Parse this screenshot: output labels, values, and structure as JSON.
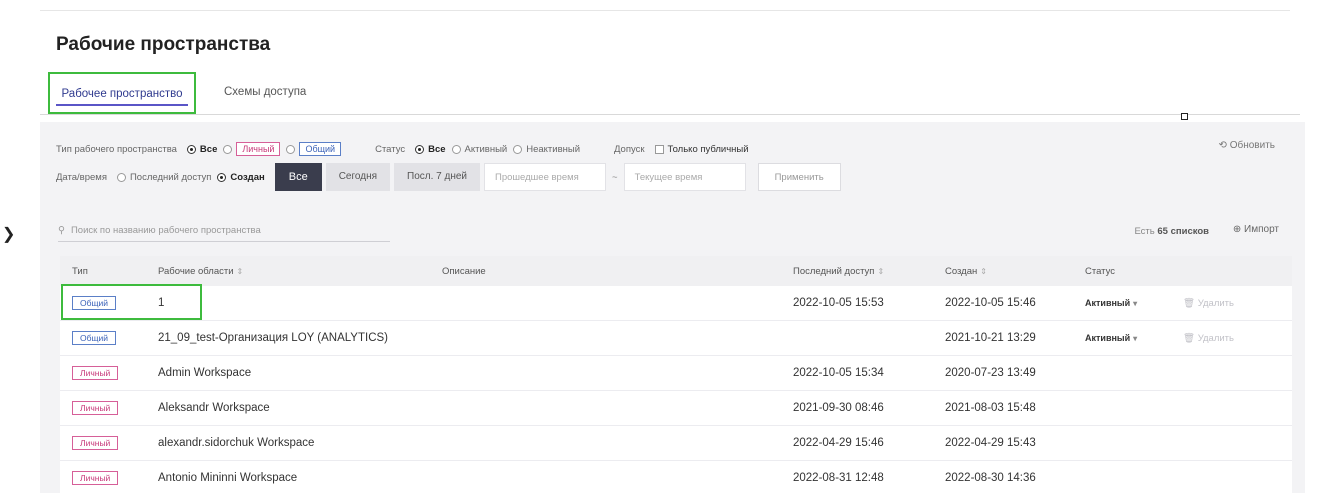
{
  "page": {
    "title": "Рабочие пространства"
  },
  "tabs": [
    {
      "label": "Рабочее пространство",
      "active": true
    },
    {
      "label": "Схемы доступа",
      "active": false
    }
  ],
  "filters": {
    "type_label": "Тип рабочего пространства",
    "type_options": {
      "all": "Все",
      "personal": "Личный",
      "shared": "Общий"
    },
    "status_label": "Статус",
    "status_options": {
      "all": "Все",
      "active": "Активный",
      "inactive": "Неактивный"
    },
    "access_label": "Допуск",
    "access_option": "Только публичный",
    "refresh_label": "Обновить",
    "datetime_label": "Дата/время",
    "date_options": {
      "last_access": "Последний доступ",
      "created": "Создан"
    },
    "periods": {
      "all": "Все",
      "today": "Сегодня",
      "last7": "Посл. 7 дней"
    },
    "start_placeholder": "Прошедшее время",
    "separator": "~",
    "end_placeholder": "Текущее время",
    "apply_label": "Применить"
  },
  "search": {
    "placeholder": "Поиск по названию рабочего пространства"
  },
  "list_info": {
    "prefix": "Есть",
    "count": "65",
    "suffix": "списков"
  },
  "import_label": "Импорт",
  "table": {
    "headers": {
      "type": "Тип",
      "name": "Рабочие области",
      "description": "Описание",
      "last_access": "Последний доступ",
      "created": "Создан",
      "status": "Статус"
    },
    "rows": [
      {
        "type": "Общий",
        "type_kind": "shared",
        "name": "1",
        "description": "",
        "last_access": "2022-10-05 15:53",
        "created": "2022-10-05 15:46",
        "status": "Активный",
        "action": "Удалить"
      },
      {
        "type": "Общий",
        "type_kind": "shared",
        "name": "21_09_test-Организация LOY (ANALYTICS)",
        "description": "",
        "last_access": "",
        "created": "2021-10-21 13:29",
        "status": "Активный",
        "action": "Удалить"
      },
      {
        "type": "Личный",
        "type_kind": "personal",
        "name": "Admin Workspace",
        "description": "",
        "last_access": "2022-10-05 15:34",
        "created": "2020-07-23 13:49",
        "status": "",
        "action": ""
      },
      {
        "type": "Личный",
        "type_kind": "personal",
        "name": "Aleksandr Workspace",
        "description": "",
        "last_access": "2021-09-30 08:46",
        "created": "2021-08-03 15:48",
        "status": "",
        "action": ""
      },
      {
        "type": "Личный",
        "type_kind": "personal",
        "name": "alexandr.sidorchuk Workspace",
        "description": "",
        "last_access": "2022-04-29 15:46",
        "created": "2022-04-29 15:43",
        "status": "",
        "action": ""
      },
      {
        "type": "Личный",
        "type_kind": "personal",
        "name": "Antonio Mininni Workspace",
        "description": "",
        "last_access": "2022-08-31 12:48",
        "created": "2022-08-30 14:36",
        "status": "",
        "action": ""
      }
    ]
  },
  "colors": {
    "accent": "#5a55c7",
    "highlight": "#3dbb3d",
    "shared": "#3b62b8",
    "personal": "#c83a7a"
  }
}
